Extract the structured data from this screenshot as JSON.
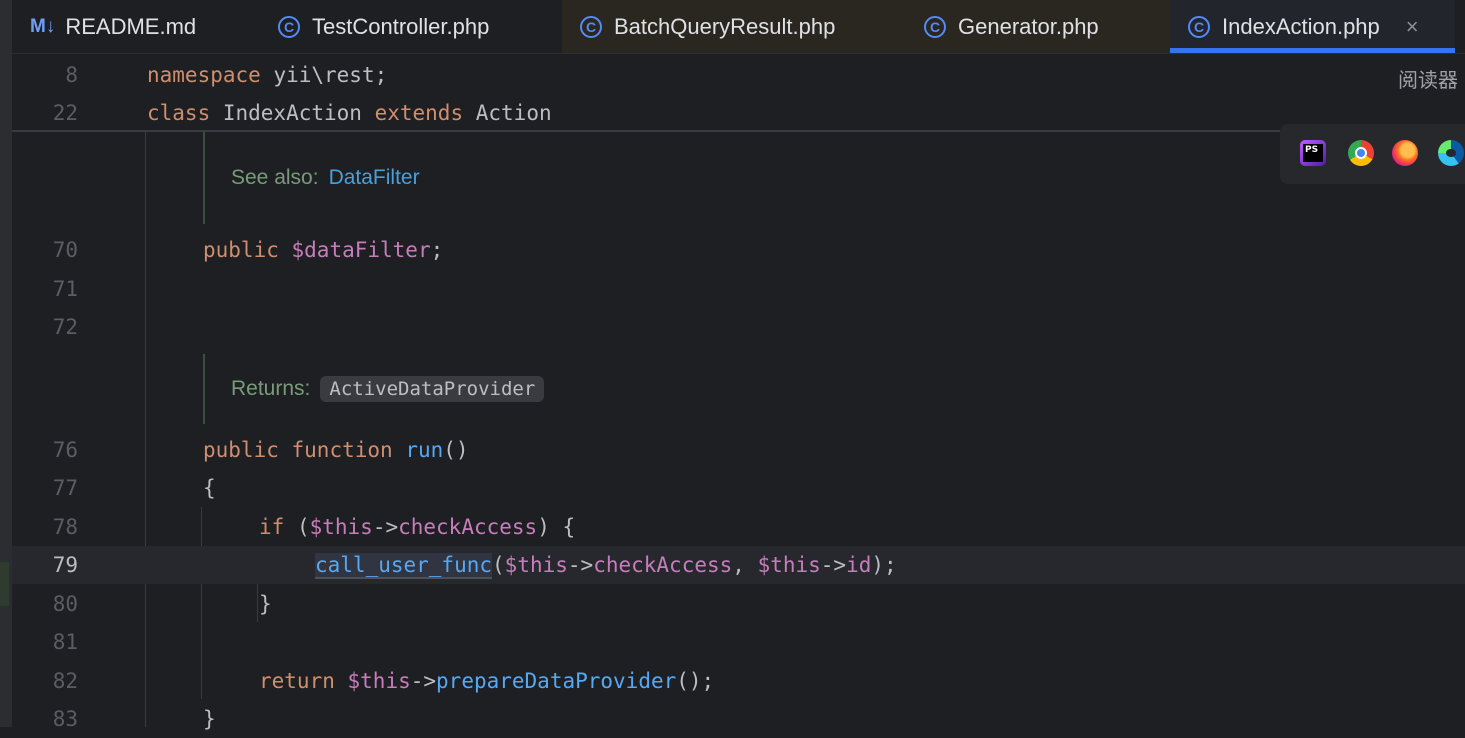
{
  "tabs": [
    {
      "label": "README.md",
      "icon": "markdown-icon",
      "icon_text": "M↓",
      "state": "normal"
    },
    {
      "label": "TestController.php",
      "icon": "php-class-icon",
      "icon_text": "C",
      "state": "normal"
    },
    {
      "label": "BatchQueryResult.php",
      "icon": "php-class-icon",
      "icon_text": "C",
      "state": "modified"
    },
    {
      "label": "Generator.php",
      "icon": "php-class-icon",
      "icon_text": "C",
      "state": "modified"
    },
    {
      "label": "IndexAction.php",
      "icon": "php-class-icon",
      "icon_text": "C",
      "state": "active",
      "close": "×"
    }
  ],
  "sticky": [
    {
      "ln": "8",
      "tokens": [
        {
          "t": "namespace",
          "c": "kw"
        },
        {
          "t": " yii\\rest;",
          "c": "plain"
        }
      ]
    },
    {
      "ln": "22",
      "tokens": [
        {
          "t": "class",
          "c": "kw"
        },
        {
          "t": " IndexAction ",
          "c": "plain"
        },
        {
          "t": "extends",
          "c": "kw"
        },
        {
          "t": " Action",
          "c": "plain"
        }
      ]
    }
  ],
  "doc_see_also": {
    "label": "See also:",
    "link": "DataFilter"
  },
  "doc_returns": {
    "label": "Returns:",
    "type": "ActiveDataProvider"
  },
  "code_lines": [
    {
      "ln": "70",
      "indent": 4,
      "tokens": [
        {
          "t": "public",
          "c": "kw"
        },
        {
          "t": " ",
          "c": "plain"
        },
        {
          "t": "$dataFilter",
          "c": "var"
        },
        {
          "t": ";",
          "c": "plain"
        }
      ]
    },
    {
      "ln": "71",
      "indent": 0,
      "tokens": []
    },
    {
      "ln": "72",
      "indent": 0,
      "tokens": []
    },
    {
      "ln": "76",
      "indent": 4,
      "tokens": [
        {
          "t": "public",
          "c": "kw"
        },
        {
          "t": " ",
          "c": "plain"
        },
        {
          "t": "function",
          "c": "kw"
        },
        {
          "t": " ",
          "c": "plain"
        },
        {
          "t": "run",
          "c": "fn"
        },
        {
          "t": "()",
          "c": "plain"
        }
      ]
    },
    {
      "ln": "77",
      "indent": 4,
      "tokens": [
        {
          "t": "{",
          "c": "plain"
        }
      ]
    },
    {
      "ln": "78",
      "indent": 8,
      "tokens": [
        {
          "t": "if",
          "c": "kw"
        },
        {
          "t": " (",
          "c": "plain"
        },
        {
          "t": "$this",
          "c": "var"
        },
        {
          "t": "->",
          "c": "plain"
        },
        {
          "t": "checkAccess",
          "c": "var"
        },
        {
          "t": ") {",
          "c": "plain"
        }
      ]
    },
    {
      "ln": "79",
      "indent": 12,
      "current": true,
      "tokens": [
        {
          "t": "call_user_func",
          "c": "fn hl"
        },
        {
          "t": "(",
          "c": "plain"
        },
        {
          "t": "$this",
          "c": "var"
        },
        {
          "t": "->",
          "c": "plain"
        },
        {
          "t": "checkAccess",
          "c": "var"
        },
        {
          "t": ", ",
          "c": "plain"
        },
        {
          "t": "$this",
          "c": "var"
        },
        {
          "t": "->",
          "c": "plain"
        },
        {
          "t": "id",
          "c": "var"
        },
        {
          "t": ");",
          "c": "plain"
        }
      ]
    },
    {
      "ln": "80",
      "indent": 8,
      "tokens": [
        {
          "t": "}",
          "c": "plain"
        }
      ]
    },
    {
      "ln": "81",
      "indent": 0,
      "tokens": []
    },
    {
      "ln": "82",
      "indent": 8,
      "tokens": [
        {
          "t": "return",
          "c": "kw"
        },
        {
          "t": " ",
          "c": "plain"
        },
        {
          "t": "$this",
          "c": "var"
        },
        {
          "t": "->",
          "c": "plain"
        },
        {
          "t": "prepareDataProvider",
          "c": "fn"
        },
        {
          "t": "();",
          "c": "plain"
        }
      ]
    },
    {
      "ln": "83",
      "indent": 4,
      "tokens": [
        {
          "t": "}",
          "c": "plain"
        }
      ]
    }
  ],
  "reader_mode_label": "阅读器",
  "browser_icons": [
    "phpstorm-icon",
    "chrome-icon",
    "firefox-icon",
    "edge-icon"
  ],
  "colors": {
    "keyword": "#cf8e6d",
    "variable": "#c77dbb",
    "function": "#56a8f5",
    "text": "#bcbec4",
    "accent": "#3574f0"
  }
}
